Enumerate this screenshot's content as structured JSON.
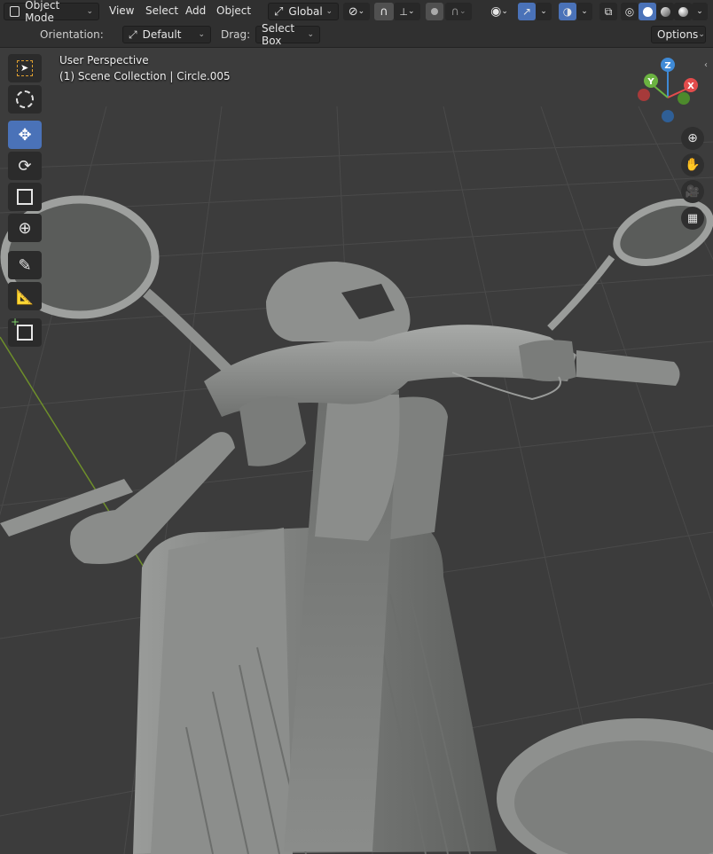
{
  "header": {
    "mode_label": "Object Mode",
    "menus": [
      "View",
      "Select",
      "Add",
      "Object"
    ],
    "transform_orientation": "Global"
  },
  "tool_settings": {
    "orientation_label": "Orientation:",
    "orientation_value": "Default",
    "drag_label": "Drag:",
    "drag_value": "Select Box",
    "options_label": "Options"
  },
  "viewport": {
    "perspective_text": "User Perspective",
    "collection_text": "(1) Scene Collection | Circle.005"
  },
  "gizmo": {
    "z_label": "Z",
    "y_label": "Y",
    "x_label": "X",
    "colors": {
      "x": "#e34c4c",
      "y": "#6bb341",
      "z": "#3f8ad6"
    }
  },
  "toolbar_icons": [
    "select-box-icon",
    "cursor-icon",
    "move-icon",
    "rotate-icon",
    "scale-icon",
    "transform-icon",
    "annotate-icon",
    "measure-icon",
    "add-cube-icon"
  ],
  "colors": {
    "accent": "#4a72b8",
    "header_bg": "#303030",
    "viewport_bg": "#3c3c3c"
  }
}
